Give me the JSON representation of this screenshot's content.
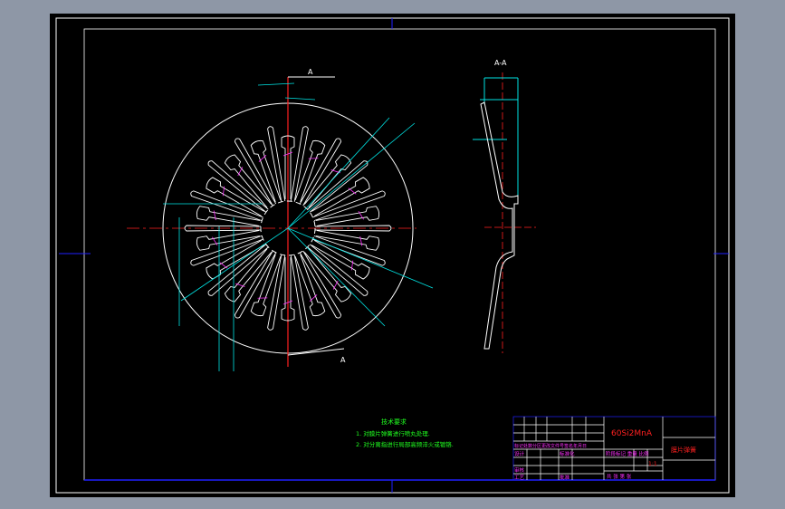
{
  "drawing": {
    "section_label": "A-A",
    "cut_label_top": "A",
    "cut_label_bottom": "A",
    "notes": {
      "title": "技术要求",
      "items": [
        "1. 对膜片弹簧进行喷丸处理.",
        "2. 对分离指进行局部高频淬火或镀铬."
      ]
    },
    "title_block": {
      "material": "60Si2MnA",
      "part_name": "膜片弹簧",
      "scale": "1:1",
      "row_labels": [
        "标记处数分区更改文件号签名年月日",
        "设计",
        "标准化",
        "审核",
        "工艺",
        "批准"
      ],
      "stage_header": "阶段标记 重量 比例",
      "sheet_info": "共 张 第 张"
    },
    "colors": {
      "outline": "#ffffff",
      "centerline": "#ff0000",
      "dimension": "#00ffff",
      "text": "#00ff00",
      "annotation": "#ff00ff",
      "frame": "#0000ff",
      "material_text": "#ff0000"
    }
  }
}
